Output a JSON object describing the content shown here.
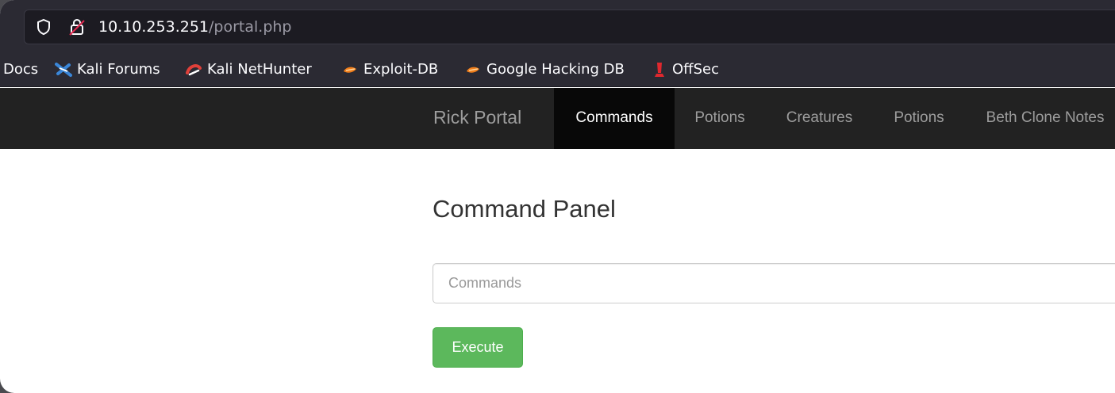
{
  "browser": {
    "url_host": "10.10.253.251",
    "url_path": "/portal.php",
    "bookmarks": [
      {
        "label": "Docs",
        "icon": "none"
      },
      {
        "label": "Kali Forums",
        "icon": "kali-dragon-icon"
      },
      {
        "label": "Kali NetHunter",
        "icon": "nethunter-icon"
      },
      {
        "label": "Exploit-DB",
        "icon": "exploitdb-icon"
      },
      {
        "label": "Google Hacking DB",
        "icon": "ghdb-icon"
      },
      {
        "label": "OffSec",
        "icon": "offsec-icon"
      }
    ]
  },
  "navbar": {
    "brand": "Rick Portal",
    "links": [
      {
        "label": "Commands",
        "active": true
      },
      {
        "label": "Potions",
        "active": false
      },
      {
        "label": "Creatures",
        "active": false
      },
      {
        "label": "Potions",
        "active": false
      },
      {
        "label": "Beth Clone Notes",
        "active": false
      }
    ]
  },
  "main": {
    "title": "Command Panel",
    "input_placeholder": "Commands",
    "input_value": "",
    "execute_label": "Execute"
  },
  "colors": {
    "navbar_bg": "#222222",
    "active_tab_bg": "#080808",
    "execute_button": "#5cb85c",
    "browser_chrome": "#2b2a33"
  }
}
